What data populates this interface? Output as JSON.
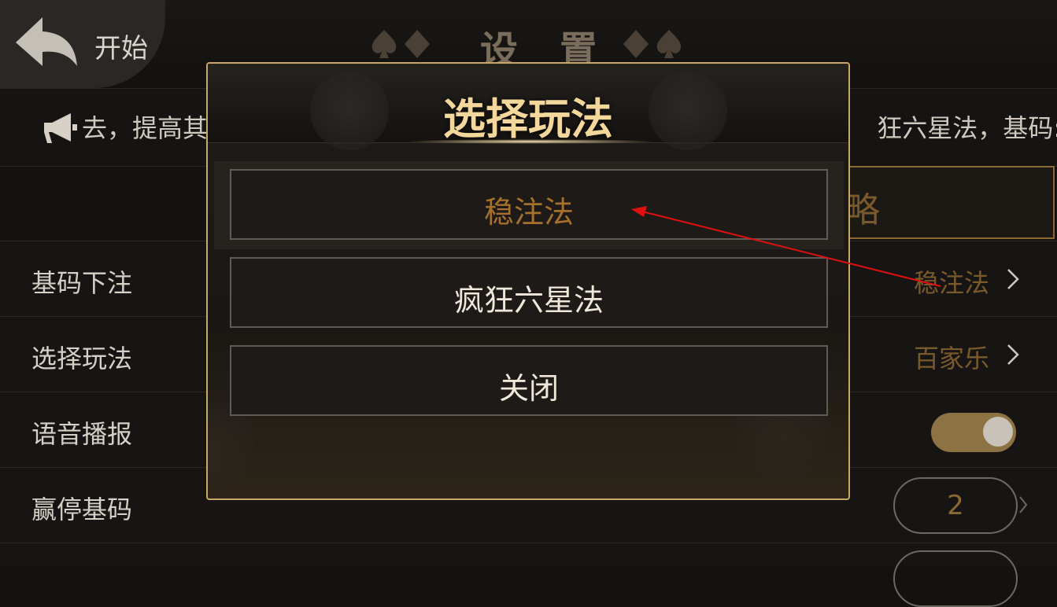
{
  "header": {
    "back_label": "开始",
    "title": "设 置"
  },
  "marquee": {
    "text_left": "去，提高其",
    "text_right": "狂六星法，基码:"
  },
  "strategy_button": {
    "label": "略"
  },
  "settings": {
    "rows": [
      {
        "label": "基码下注",
        "value": "稳注法"
      },
      {
        "label": "选择玩法",
        "value": "百家乐"
      },
      {
        "label": "语音播报",
        "toggle": true
      },
      {
        "label": "赢停基码",
        "value": "2"
      }
    ]
  },
  "dialog": {
    "title": "选择玩法",
    "options": [
      {
        "label": "稳注法",
        "selected": true
      },
      {
        "label": "疯狂六星法",
        "selected": false
      },
      {
        "label": "关闭",
        "selected": false
      }
    ]
  },
  "colors": {
    "accent_gold": "#c9a866",
    "selected_text": "#a6702d",
    "annotation_arrow": "#e01010"
  },
  "icons": [
    "back-arrow-icon",
    "spade-icon",
    "diamond-icon",
    "megaphone-icon",
    "chevron-right-icon"
  ]
}
